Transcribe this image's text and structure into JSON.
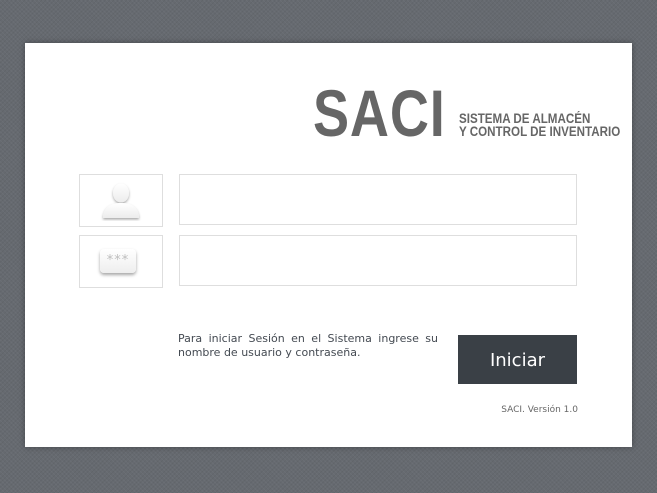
{
  "logo": {
    "main": "SACI",
    "sub_line1": "SISTEMA DE ALMACÉN",
    "sub_line2": "Y CONTROL DE INVENTARIO"
  },
  "form": {
    "username": {
      "value": "",
      "placeholder": "",
      "icon": "user-icon"
    },
    "password": {
      "value": "",
      "placeholder": "",
      "icon": "password-icon",
      "icon_text": "***"
    },
    "instructions": "Para iniciar Sesión en el Sistema ingrese su nombre de usuario y contraseña.",
    "submit_label": "Iniciar"
  },
  "footer": {
    "version": "SACI. Versión 1.0"
  },
  "colors": {
    "background": "#666a70",
    "card": "#ffffff",
    "button": "#3a4046",
    "logo": "#666666"
  }
}
